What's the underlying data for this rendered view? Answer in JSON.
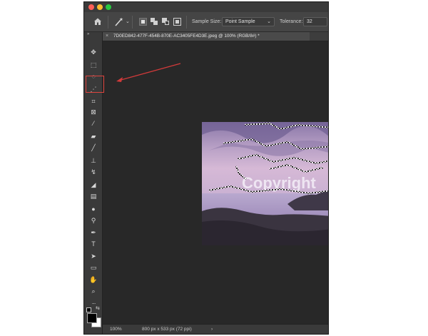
{
  "options_bar": {
    "sample_size_label": "Sample Size:",
    "sample_size_value": "Point Sample",
    "tolerance_label": "Tolerance:",
    "tolerance_value": "32"
  },
  "document": {
    "tab_title": "7D0ED842-477F-454B-870E-AC3405FE4D3E.jpeg @ 100% (RGB/8#) *",
    "watermark": "Copyright"
  },
  "status_bar": {
    "zoom": "100%",
    "doc_info": "800 px x 533 px (72 ppi)",
    "chevron": "›"
  },
  "colors": {
    "annotation_red": "#e0443e",
    "traffic_red": "#ff5f57",
    "traffic_yellow": "#febc2e",
    "traffic_green": "#28c840"
  },
  "tools": [
    {
      "icon": "move-icon",
      "glyph": "✥"
    },
    {
      "icon": "marquee-icon",
      "glyph": "⬚"
    },
    {
      "icon": "lasso-icon",
      "glyph": "◌"
    },
    {
      "icon": "magic-wand-icon",
      "glyph": "⋰"
    },
    {
      "icon": "crop-icon",
      "glyph": "⌗"
    },
    {
      "icon": "frame-icon",
      "glyph": "⊠"
    },
    {
      "icon": "eyedropper-icon",
      "glyph": "⁄"
    },
    {
      "icon": "healing-brush-icon",
      "glyph": "▰"
    },
    {
      "icon": "brush-icon",
      "glyph": "╱"
    },
    {
      "icon": "clone-stamp-icon",
      "glyph": "⊥"
    },
    {
      "icon": "history-brush-icon",
      "glyph": "↯"
    },
    {
      "icon": "eraser-icon",
      "glyph": "◢"
    },
    {
      "icon": "gradient-icon",
      "glyph": "▤"
    },
    {
      "icon": "blur-icon",
      "glyph": "●"
    },
    {
      "icon": "dodge-icon",
      "glyph": "⚲"
    },
    {
      "icon": "pen-icon",
      "glyph": "✒"
    },
    {
      "icon": "type-icon",
      "glyph": "T"
    },
    {
      "icon": "path-selection-icon",
      "glyph": "➤"
    },
    {
      "icon": "rectangle-icon",
      "glyph": "▭"
    },
    {
      "icon": "hand-icon",
      "glyph": "✋"
    },
    {
      "icon": "zoom-icon",
      "glyph": "⌕"
    },
    {
      "icon": "more-tools-icon",
      "glyph": "···"
    }
  ]
}
